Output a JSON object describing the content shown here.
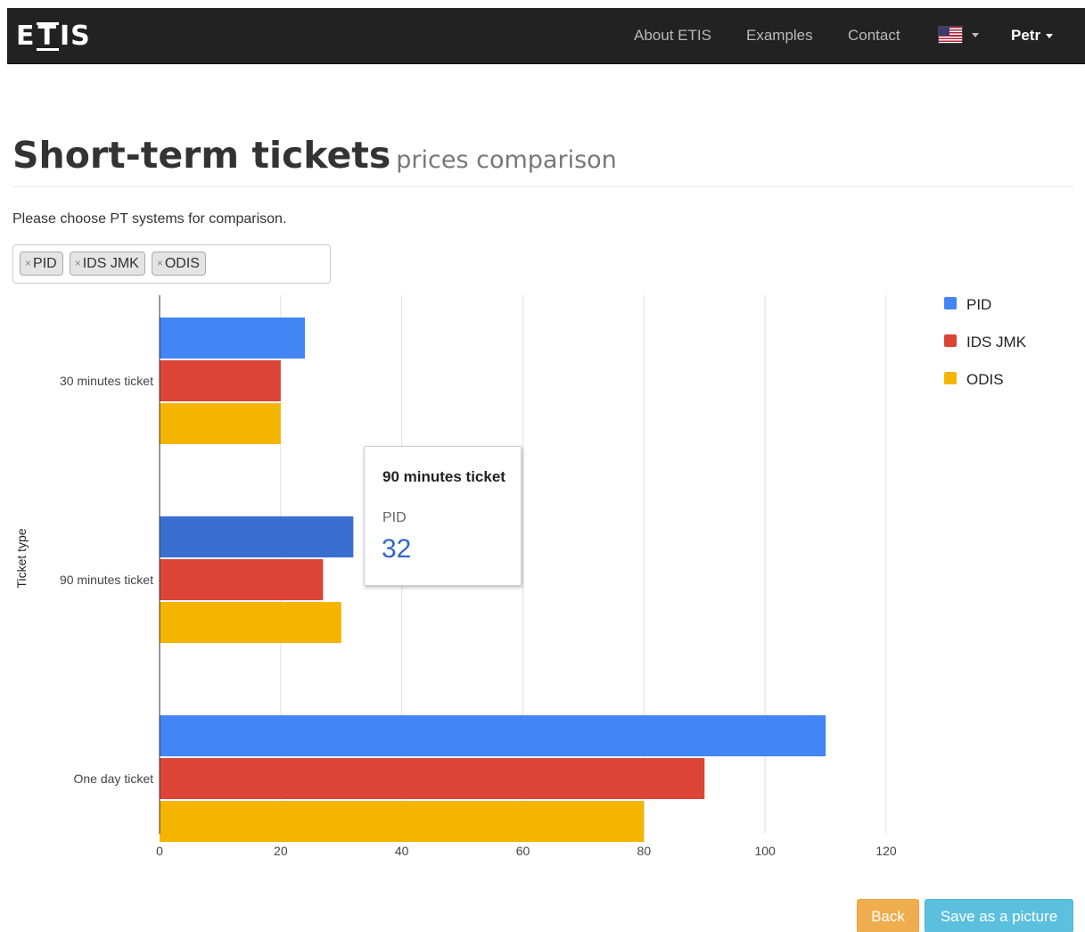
{
  "navbar": {
    "brand": {
      "left": "E",
      "boxed": "T",
      "right": "IS"
    },
    "links": [
      "About ETIS",
      "Examples",
      "Contact"
    ],
    "language_icon": "us-flag-icon",
    "user": "Petr"
  },
  "page": {
    "title": "Short-term tickets",
    "subtitle": "prices comparison",
    "prompt": "Please choose PT systems for comparison."
  },
  "selector": {
    "tags": [
      "PID",
      "IDS JMK",
      "ODIS"
    ],
    "remove_glyph": "×"
  },
  "colors": {
    "PID": "#4285f4",
    "IDS JMK": "#db4437",
    "ODIS": "#f4b400",
    "PID_hover": "#3a6fd1"
  },
  "chart_data": {
    "type": "bar",
    "orientation": "horizontal",
    "categories": [
      "30 minutes ticket",
      "90 minutes ticket",
      "One day ticket"
    ],
    "series": [
      {
        "name": "PID",
        "values": [
          24,
          32,
          110
        ]
      },
      {
        "name": "IDS JMK",
        "values": [
          20,
          27,
          90
        ]
      },
      {
        "name": "ODIS",
        "values": [
          20,
          30,
          80
        ]
      }
    ],
    "xlim": [
      0,
      120
    ],
    "xticks": [
      0,
      20,
      40,
      60,
      80,
      100,
      120
    ],
    "xlabel": "",
    "ylabel": "Ticket type",
    "grid": true,
    "legend": "right"
  },
  "tooltip": {
    "title": "90 minutes ticket",
    "series": "PID",
    "value": "32"
  },
  "buttons": {
    "back": "Back",
    "save": "Save as a picture"
  }
}
